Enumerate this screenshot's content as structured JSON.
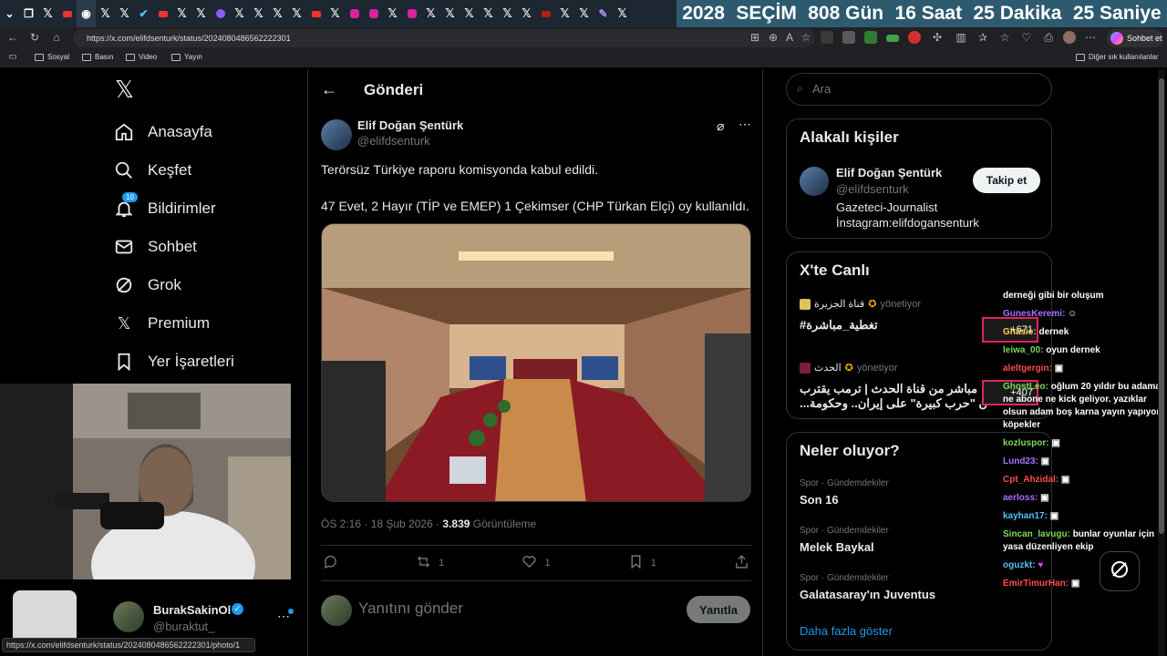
{
  "browser": {
    "countdown": [
      "2028",
      "SEÇİM",
      "808 Gün",
      "16 Saat",
      "25 Dakika",
      "25 Saniye"
    ],
    "url": "https://x.com/elifdsenturk/status/2024080486562222301",
    "sohbet_label": "Sohbet et",
    "bookmarks": [
      "Sosyal",
      "Basın",
      "Video",
      "Yayın"
    ],
    "other_bookmarks": "Diğer sık kullanılanlar",
    "status_url": "https://x.com/elifdsenturk/status/2024080486562222301/photo/1"
  },
  "nav": {
    "items": [
      {
        "label": "Anasayfa",
        "icon": "home-icon"
      },
      {
        "label": "Keşfet",
        "icon": "search-icon"
      },
      {
        "label": "Bildirimler",
        "icon": "bell-icon",
        "badge": "10"
      },
      {
        "label": "Sohbet",
        "icon": "mail-icon"
      },
      {
        "label": "Grok",
        "icon": "grok-icon"
      },
      {
        "label": "Premium",
        "icon": "x-icon"
      },
      {
        "label": "Yer İşaretleri",
        "icon": "bookmark-icon"
      }
    ],
    "profile": {
      "name": "BurakSakinOl",
      "handle": "@buraktut_"
    }
  },
  "post": {
    "header_title": "Gönderi",
    "author_name": "Elif Doğan Şentürk",
    "author_handle": "@elifdsenturk",
    "text_line1": "Terörsüz Türkiye raporu komisyonda kabul edildi.",
    "text_line2": "47 Evet, 2 Hayır (TİP ve EMEP) 1 Çekimser (CHP Türkan Elçi) oy kullanıldı.",
    "time": "ÖS 2:16 · 18 Şub 2026 · ",
    "views": "3.839",
    "views_label": " Görüntüleme",
    "retweets": "1",
    "likes": "1",
    "bookmarks": "1",
    "reply_placeholder": "Yanıtını gönder",
    "reply_button": "Yanıtla"
  },
  "right": {
    "search_placeholder": "Ara",
    "related_title": "Alakalı kişiler",
    "related_person": {
      "name": "Elif Doğan Şentürk",
      "handle": "@elifdsenturk",
      "bio1": "Gazeteci-Journalist",
      "bio2": "İnstagram:elifdogansenturk",
      "follow": "Takip et"
    },
    "live_title": "X'te Canlı",
    "live": [
      {
        "host": "قناة الجزيرة",
        "role": "yönetiyor",
        "title": "#تغطية_مباشرة",
        "count": "+671"
      },
      {
        "host": "الحدث",
        "role": "yönetiyor",
        "title1": "مباشر من قناة الحدث | ترمب يقترب",
        "title2": "...ن \"حرب كبيرة\" على إيران.. وحكومة",
        "count": "+407"
      }
    ],
    "trends_title": "Neler oluyor?",
    "trends": [
      {
        "cat": "Spor · Gündemdekiler",
        "name": "Son 16"
      },
      {
        "cat": "Spor · Gündemdekiler",
        "name": "Melek Baykal"
      },
      {
        "cat": "Spor · Gündemdekiler",
        "name": "Galatasaray'ın Juventus"
      }
    ],
    "show_more": "Daha fazla göster"
  },
  "chat": [
    {
      "user": "",
      "text": "derneği gibi bir oluşum"
    },
    {
      "user": "GunesKeremi:",
      "text": "",
      "color": "u-purple"
    },
    {
      "user": "Ghasie:",
      "text": "dernek",
      "color": "u-yellow"
    },
    {
      "user": "leiwa_00:",
      "text": "oyun dernek",
      "color": "u-green"
    },
    {
      "user": "aleltgergin:",
      "text": "",
      "color": "u-red"
    },
    {
      "user": "GhostLeo:",
      "text": "oğlum 20 yıldır bu adama ne abone ne kick geliyor. yazıklar olsun adam boş karna yayın yapıyor köpekler",
      "color": "u-green"
    },
    {
      "user": "kozluspor:",
      "text": "",
      "color": "u-green"
    },
    {
      "user": "Lund23:",
      "text": "",
      "color": "u-purple"
    },
    {
      "user": "Cpt_Ahzidal:",
      "text": "",
      "color": "u-red"
    },
    {
      "user": "aerloss:",
      "text": "",
      "color": "u-purple"
    },
    {
      "user": "kayhan17:",
      "text": "",
      "color": "u-blue"
    },
    {
      "user": "Sincan_lavugu:",
      "text": "bunlar oyunlar için yasa düzenliyen ekip",
      "color": "u-green"
    },
    {
      "user": "oguzkt:",
      "text": "",
      "color": "u-blue"
    },
    {
      "user": "EmirTimurHan:",
      "text": "",
      "color": "u-red"
    }
  ]
}
